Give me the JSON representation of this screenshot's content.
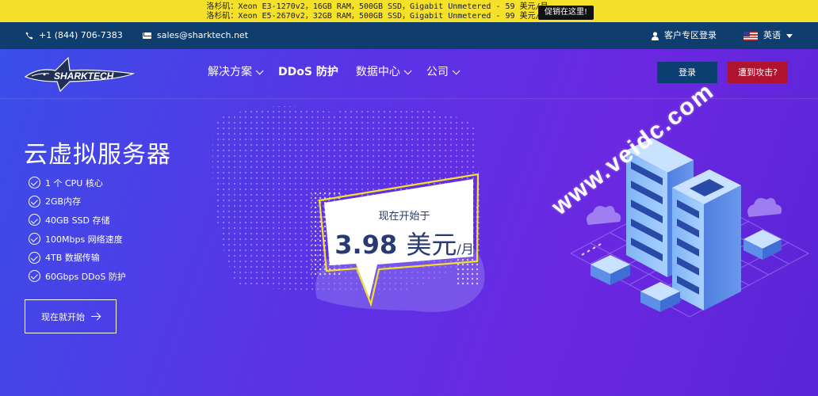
{
  "promo": {
    "line1": "洛杉矶：Xeon E3-1270v2，16GB RAM，500GB SSD，Gigabit Unmetered - 59 美元/月",
    "line2": "洛杉矶：Xeon E5-2670v2，32GB RAM，500GB SSD，Gigabit Unmetered - 99 美元/月",
    "button_label": "促销在这里!",
    "bg_color": "#f6e12a"
  },
  "infobar": {
    "phone": "+1 (844) 706-7383",
    "email": "sales@sharktech.net",
    "login": "客户专区登录",
    "language": "英语",
    "bg_color": "#0e3d6e",
    "icons": [
      "phone-icon",
      "mail-icon",
      "user-icon",
      "us-flag-icon",
      "caret-down-icon"
    ]
  },
  "header": {
    "logo_text": "SHARKTECH",
    "nav": [
      {
        "label": "解决方案",
        "has_dropdown": true
      },
      {
        "label": "DDoS 防护",
        "has_dropdown": false
      },
      {
        "label": "数据中心",
        "has_dropdown": true
      },
      {
        "label": "公司",
        "has_dropdown": true
      }
    ],
    "login_button": "登录",
    "attack_button": "遭到攻击?",
    "login_color": "#0b3f72",
    "attack_color": "#b0132e"
  },
  "hero": {
    "title": "云虚拟服务器",
    "features": [
      "1 个 CPU 核心",
      "2GB内存",
      "40GB SSD 存储",
      "100Mbps 网络速度",
      "4TB 数据传输",
      "60Gbps DDoS 防护"
    ],
    "cta_label": "现在就开始"
  },
  "price_bubble": {
    "subtitle": "现在开始于",
    "price": "3.98",
    "currency": "美元",
    "period": "/月"
  },
  "watermark": "www.veidc.com"
}
